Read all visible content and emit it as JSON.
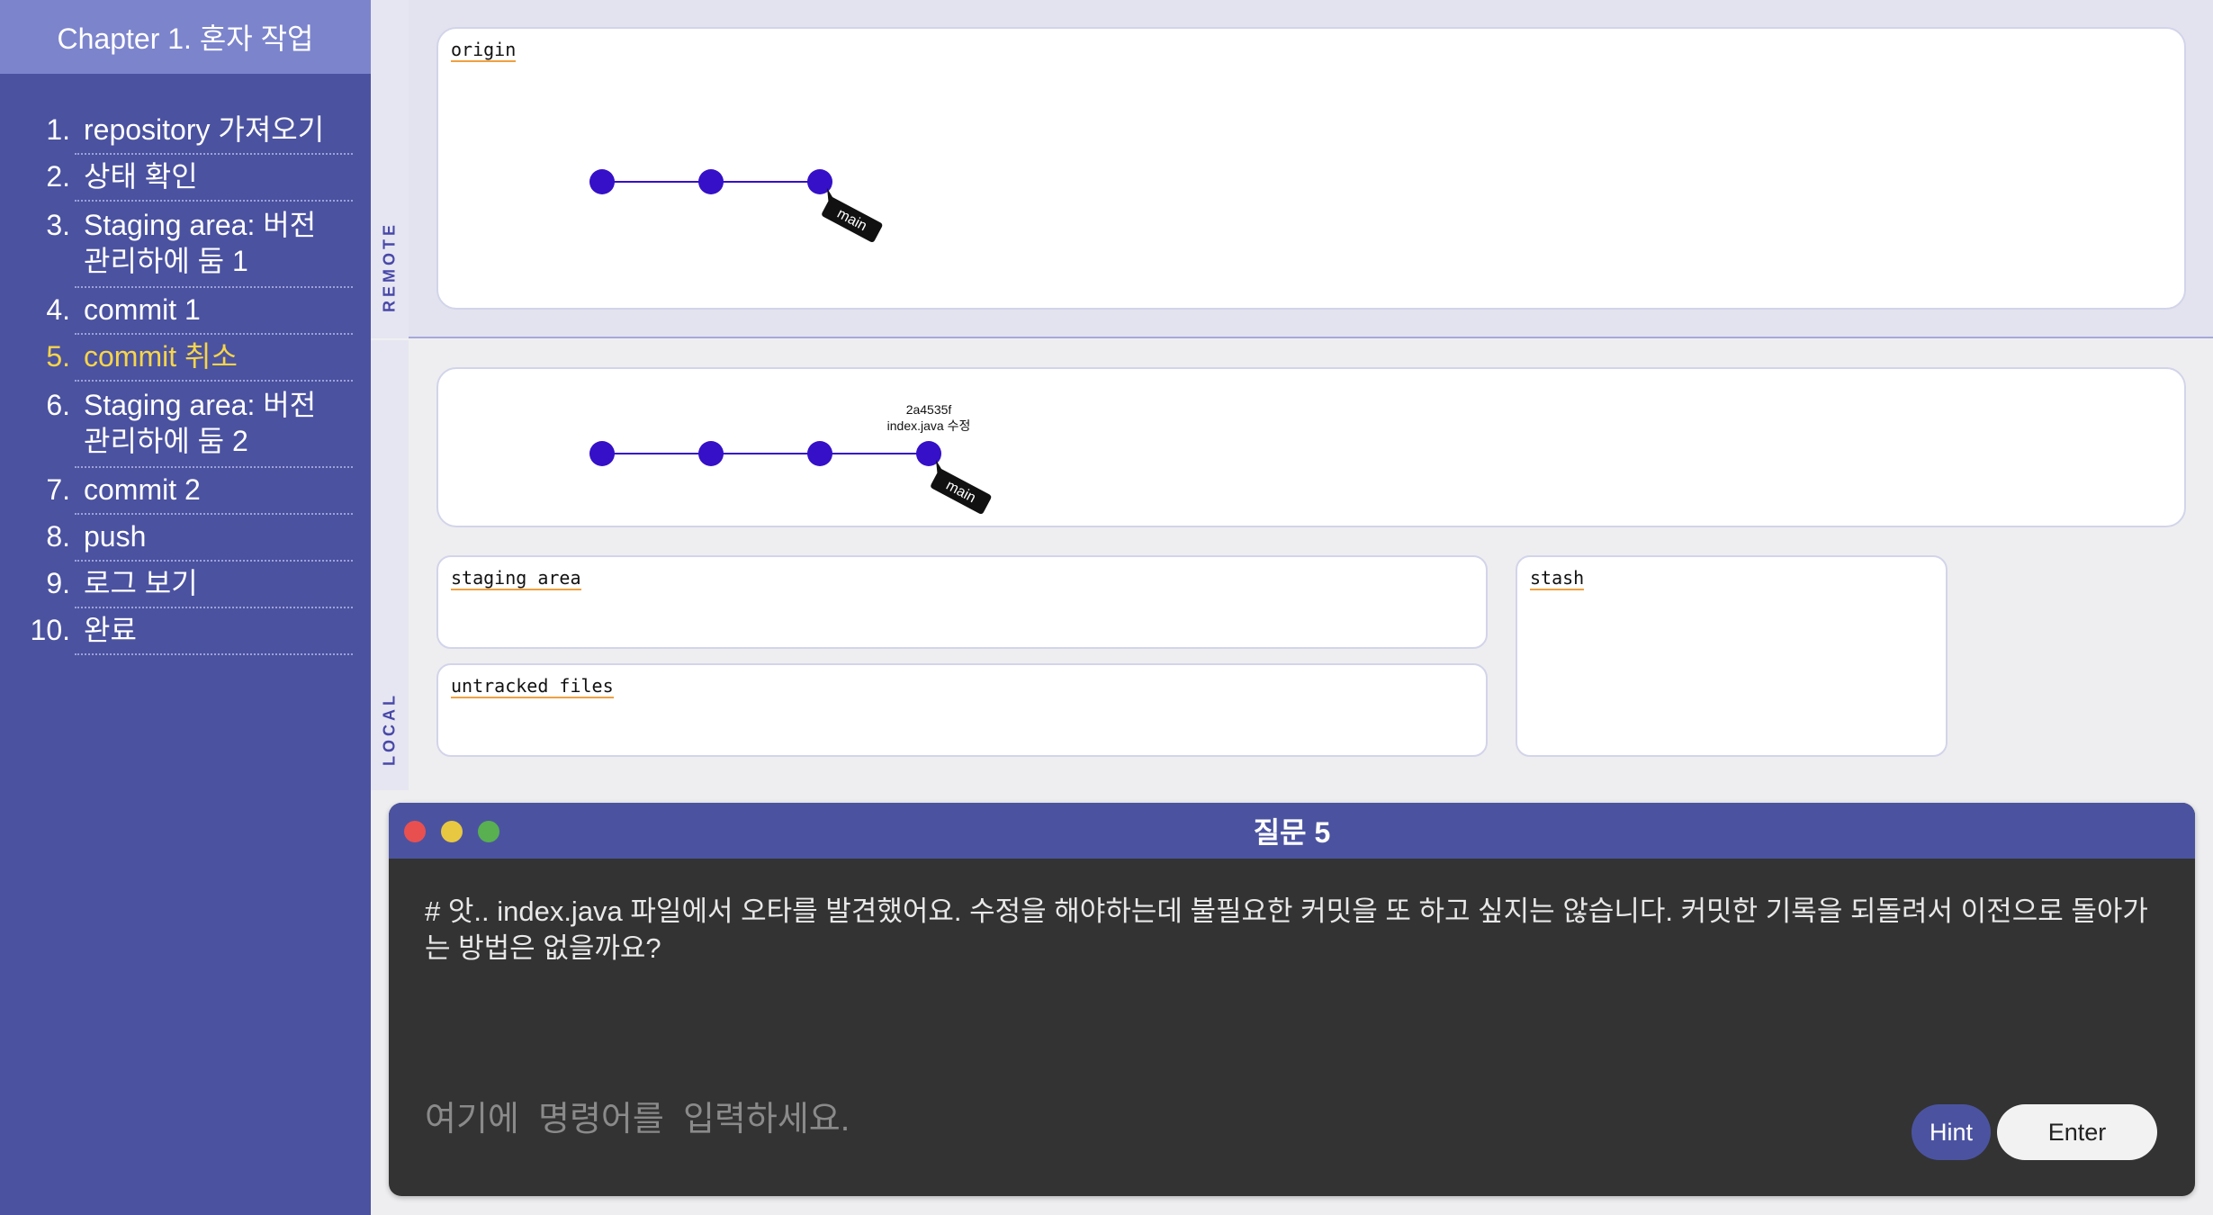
{
  "sidebar": {
    "title": "Chapter 1. 혼자 작업",
    "items": [
      {
        "num": "1.",
        "label": "repository 가져오기"
      },
      {
        "num": "2.",
        "label": "상태 확인"
      },
      {
        "num": "3.",
        "label": "Staging area: 버전 관리하에 둠 1"
      },
      {
        "num": "4.",
        "label": "commit 1"
      },
      {
        "num": "5.",
        "label": "commit 취소",
        "active": true
      },
      {
        "num": "6.",
        "label": "Staging area: 버전 관리하에 둠 2"
      },
      {
        "num": "7.",
        "label": "commit 2"
      },
      {
        "num": "8.",
        "label": "push"
      },
      {
        "num": "9.",
        "label": "로그 보기"
      },
      {
        "num": "10.",
        "label": "완료"
      }
    ]
  },
  "remote": {
    "label": "REMOTE",
    "origin_title": "origin",
    "commit_count": 3,
    "branch": "main"
  },
  "local": {
    "label": "LOCAL",
    "commit_count": 4,
    "branch": "main",
    "head_commit": {
      "hash": "2a4535f",
      "message": "index.java 수정"
    },
    "staging_title": "staging area",
    "untracked_title": "untracked files",
    "stash_title": "stash"
  },
  "question": {
    "title": "질문 5",
    "text": "# 앗.. index.java 파일에서 오타를 발견했어요. 수정을 해야하는데 불필요한 커밋을 또 하고 싶지는 않습니다. 커밋한 기록을 되돌려서 이전으로 돌아가는 방법은 없을까요?",
    "input_placeholder": "여기에  명령어를  입력하세요.",
    "input_value": "",
    "hint_label": "Hint",
    "enter_label": "Enter"
  },
  "colors": {
    "sidebar_bg": "#4b52a0",
    "sidebar_header": "#7c84cc",
    "active_item": "#f7d54a",
    "commit_node": "#3510c8",
    "branch_tag": "#111111",
    "underline": "#f0a040"
  }
}
